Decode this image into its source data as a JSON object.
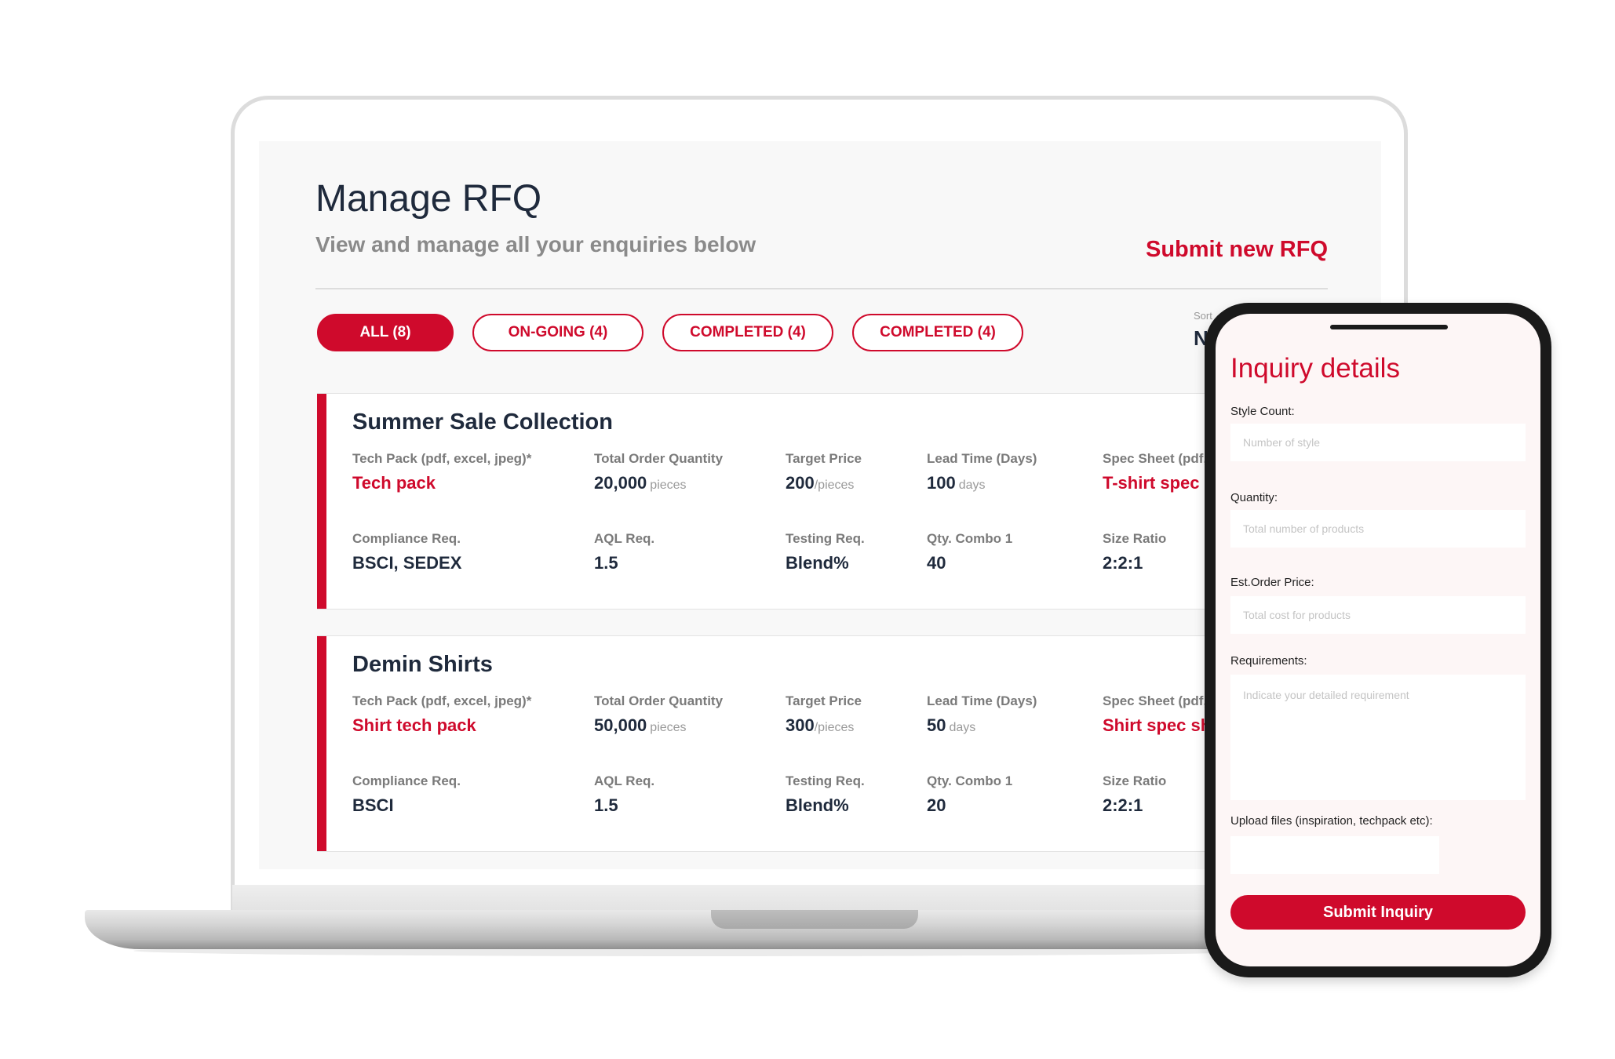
{
  "header": {
    "title": "Manage RFQ",
    "subtitle": "View and manage all your enquiries below",
    "submit_new": "Submit new RFQ"
  },
  "tabs": [
    {
      "label": "ALL (8)",
      "active": true
    },
    {
      "label": "ON-GOING (4)",
      "active": false
    },
    {
      "label": "COMPLETED (4)",
      "active": false
    },
    {
      "label": "COMPLETED (4)",
      "active": false
    }
  ],
  "sort": {
    "label": "Sort",
    "value": "N"
  },
  "rfqs": [
    {
      "title": "Summer Sale Collection",
      "tech_pack": {
        "label": "Tech Pack (pdf, excel, jpeg)*",
        "value": "Tech pack"
      },
      "total_order": {
        "label": "Total Order Quantity",
        "value": "20,000",
        "unit": "pieces"
      },
      "target_price": {
        "label": "Target Price",
        "value": "200",
        "unit": "/pieces"
      },
      "lead_time": {
        "label": "Lead Time (Days)",
        "value": "100",
        "unit": "days"
      },
      "spec_sheet": {
        "label": "Spec Sheet (pdf,",
        "value": "T-shirt spec s"
      },
      "compliance": {
        "label": "Compliance Req.",
        "value": "BSCI, SEDEX"
      },
      "aql": {
        "label": "AQL Req.",
        "value": "1.5"
      },
      "testing": {
        "label": "Testing Req.",
        "value": "Blend%"
      },
      "qty_combo": {
        "label": "Qty. Combo 1",
        "value": "40"
      },
      "size_ratio": {
        "label": "Size Ratio",
        "value": "2:2:1"
      }
    },
    {
      "title": "Demin Shirts",
      "tech_pack": {
        "label": "Tech Pack (pdf, excel, jpeg)*",
        "value": "Shirt tech pack"
      },
      "total_order": {
        "label": "Total Order Quantity",
        "value": "50,000",
        "unit": "pieces"
      },
      "target_price": {
        "label": "Target Price",
        "value": "300",
        "unit": "/pieces"
      },
      "lead_time": {
        "label": "Lead Time (Days)",
        "value": "50",
        "unit": "days"
      },
      "spec_sheet": {
        "label": "Spec Sheet (pdf,",
        "value": "Shirt spec she"
      },
      "compliance": {
        "label": "Compliance Req.",
        "value": "BSCI"
      },
      "aql": {
        "label": "AQL Req.",
        "value": "1.5"
      },
      "testing": {
        "label": "Testing Req.",
        "value": "Blend%"
      },
      "qty_combo": {
        "label": "Qty. Combo 1",
        "value": "20"
      },
      "size_ratio": {
        "label": "Size Ratio",
        "value": "2:2:1"
      }
    }
  ],
  "inquiry": {
    "title": "Inquiry details",
    "style_count": {
      "label": "Style Count:",
      "placeholder": "Number of style"
    },
    "quantity": {
      "label": "Quantity:",
      "placeholder": "Total number of products"
    },
    "est_price": {
      "label": "Est.Order Price:",
      "placeholder": "Total cost for products"
    },
    "requirements": {
      "label": "Requirements:",
      "placeholder": "Indicate your detailed requirement"
    },
    "upload": {
      "label": "Upload files (inspiration, techpack etc):"
    },
    "submit": "Submit Inquiry"
  },
  "colors": {
    "accent": "#cf0a2c",
    "heading": "#1f2a3c",
    "muted": "#7a7a7a"
  }
}
